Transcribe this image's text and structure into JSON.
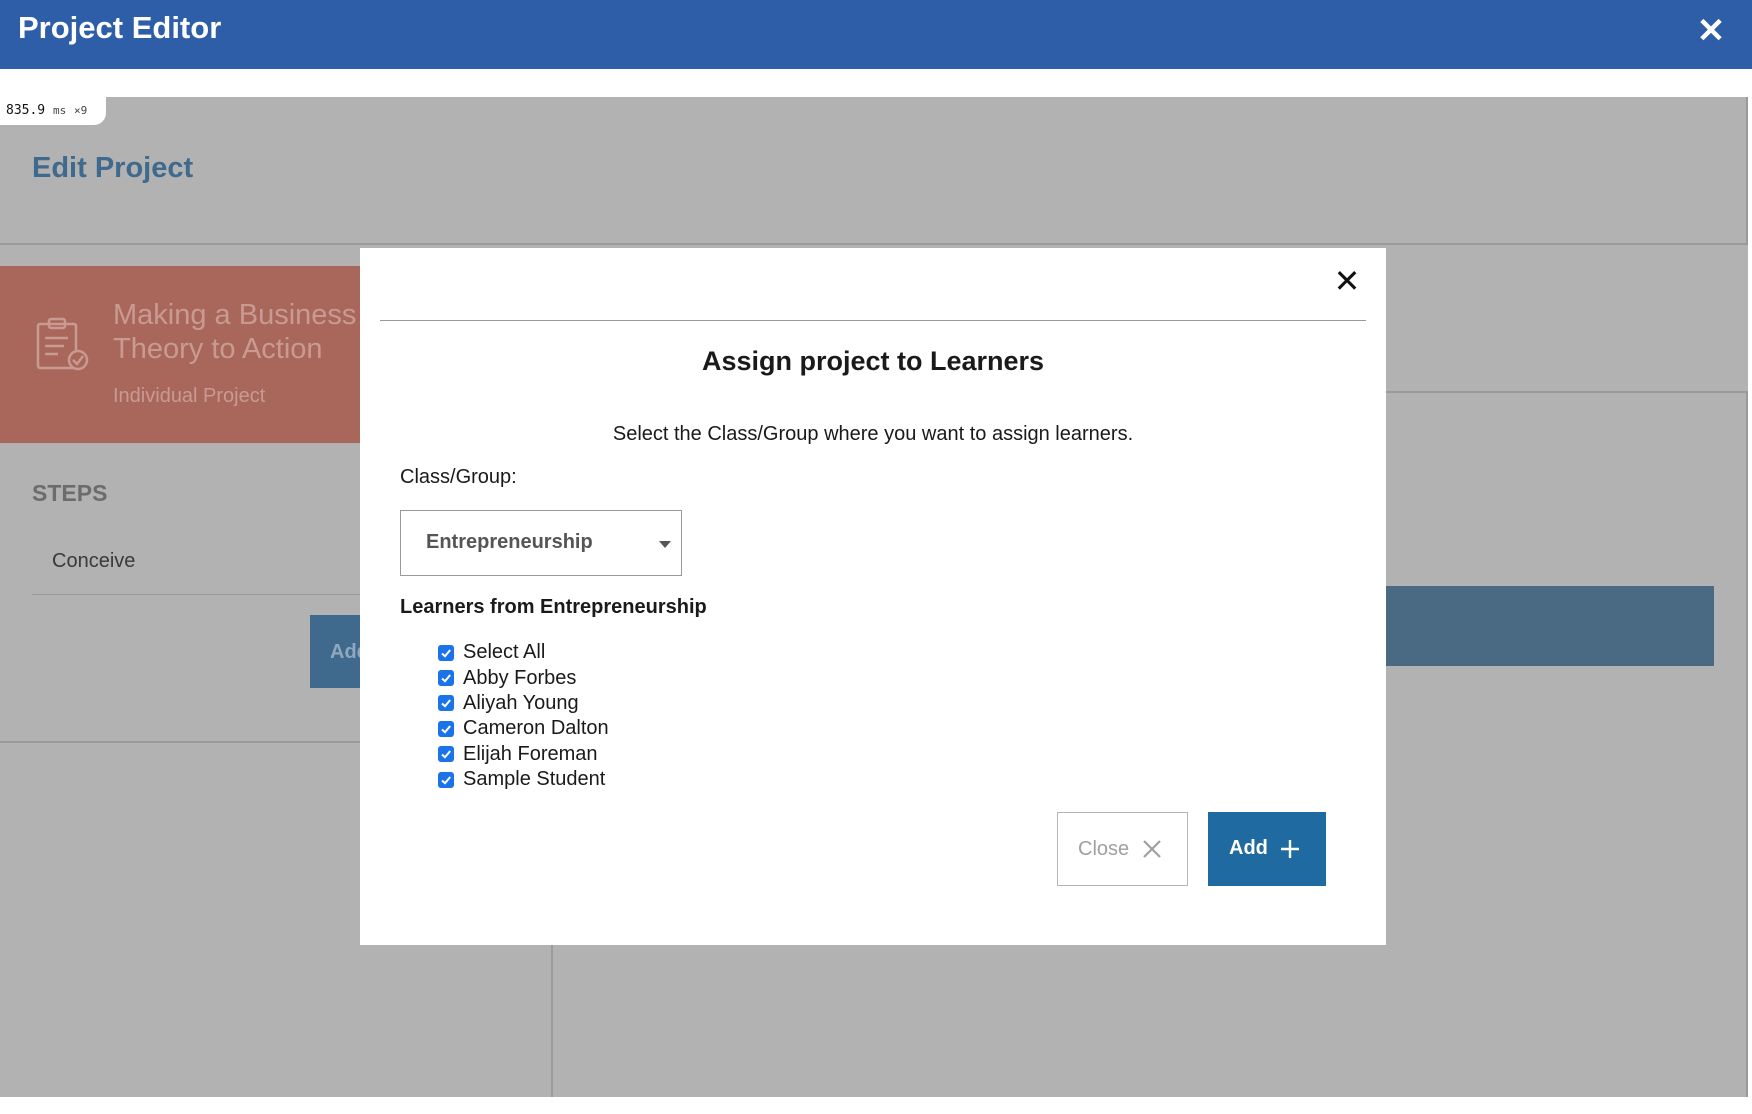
{
  "appbar": {
    "title": "Project Editor",
    "close_glyph": "✕"
  },
  "perf": {
    "value": "835.9",
    "unit": "ms",
    "count": "×9"
  },
  "background": {
    "edit_title": "Edit Project",
    "project": {
      "title_line1": "Making a Business I",
      "title_line2": "Theory to Action",
      "subtitle": "Individual Project",
      "icon": "clipboard-check-icon"
    },
    "steps_heading": "STEPS",
    "steps": [
      "Conceive"
    ],
    "add_step_label": "Add"
  },
  "modal": {
    "close_glyph": "✕",
    "title": "Assign project to Learners",
    "instruction": "Select the Class/Group where you want to assign learners.",
    "class_label": "Class/Group:",
    "selected_class": "Entrepreneurship",
    "learners_heading": "Learners from Entrepreneurship",
    "learners": [
      {
        "name": "Select All",
        "checked": true
      },
      {
        "name": "Abby Forbes",
        "checked": true
      },
      {
        "name": "Aliyah Young",
        "checked": true
      },
      {
        "name": "Cameron Dalton",
        "checked": true
      },
      {
        "name": "Elijah Foreman",
        "checked": true
      },
      {
        "name": "Sample Student",
        "checked": true
      }
    ],
    "close_button": "Close",
    "add_button": "Add"
  },
  "colors": {
    "appbar": "#2f5ea8",
    "checkbox": "#1a73e8",
    "add_button": "#1f6aa0",
    "overlay": "#b2b2b3"
  }
}
